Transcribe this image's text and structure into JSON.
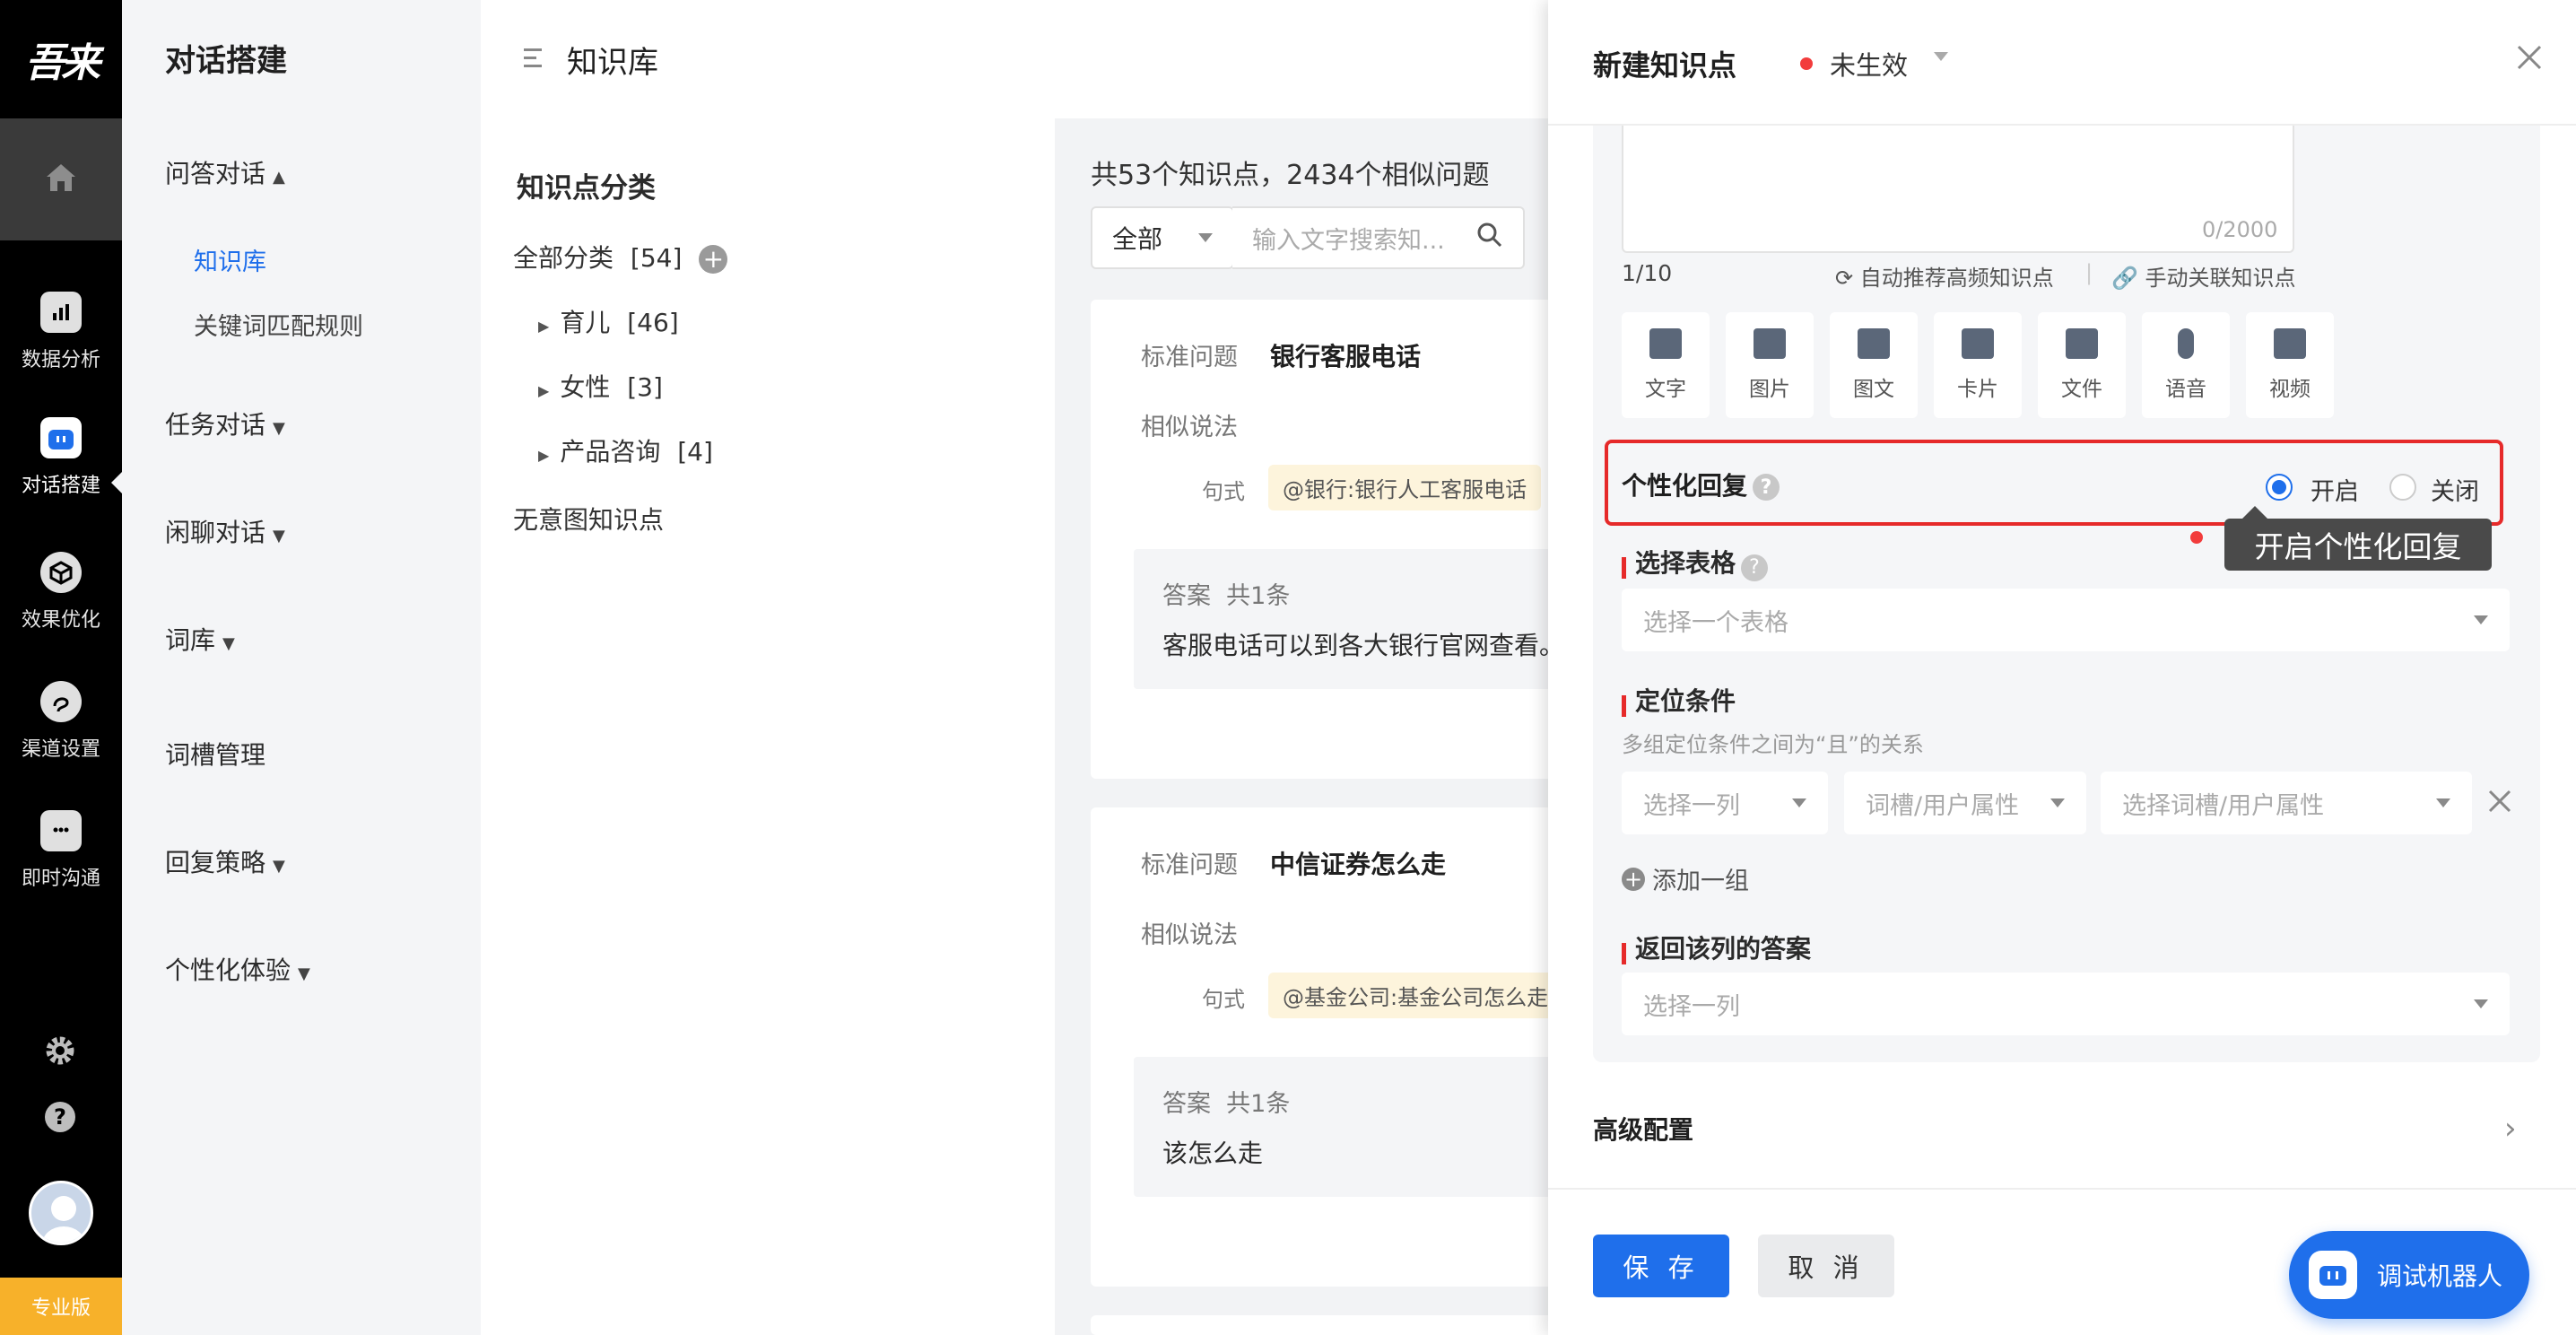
{
  "brand": {
    "logo": "吾来",
    "plan_badge": "专业版"
  },
  "rail": {
    "items": [
      {
        "label": "数据分析",
        "icon": "bar-chart-icon"
      },
      {
        "label": "对话搭建",
        "icon": "robot-icon"
      },
      {
        "label": "效果优化",
        "icon": "cube-icon"
      },
      {
        "label": "渠道设置",
        "icon": "channel-icon"
      },
      {
        "label": "即时沟通",
        "icon": "chat-bubble-icon"
      }
    ]
  },
  "nav2": {
    "title": "对话搭建",
    "items": [
      {
        "label": "问答对话"
      },
      {
        "label": "任务对话"
      },
      {
        "label": "闲聊对话"
      },
      {
        "label": "词库"
      },
      {
        "label": "词槽管理"
      },
      {
        "label": "回复策略"
      },
      {
        "label": "个性化体验"
      }
    ],
    "sub_items": [
      {
        "label": "知识库"
      },
      {
        "label": "关键词匹配规则"
      }
    ]
  },
  "main": {
    "title": "知识库",
    "category_title": "知识点分类",
    "categories": [
      {
        "label": "全部分类",
        "count": "[54]"
      },
      {
        "label": "育儿",
        "count": "[46]"
      },
      {
        "label": "女性",
        "count": "[3]"
      },
      {
        "label": "产品咨询",
        "count": "[4]"
      },
      {
        "label": "无意图知识点",
        "count": ""
      }
    ],
    "summary": "共53个知识点，2434个相似问题",
    "filter_value": "全部",
    "search_placeholder": "输入文字搜索知...",
    "cards": [
      {
        "std_label": "标准问题",
        "std_value": "银行客服电话",
        "sim_label": "相似说法",
        "pattern_label": "句式",
        "pattern_tag": "@银行:银行人工客服电话",
        "answer_label": "答案",
        "answer_count": "共1条",
        "answer_text": "客服电话可以到各大银行官网查看。"
      },
      {
        "std_label": "标准问题",
        "std_value": "中信证券怎么走",
        "sim_label": "相似说法",
        "pattern_label": "句式",
        "pattern_tag": "@基金公司:基金公司怎么走",
        "answer_label": "答案",
        "answer_count": "共1条",
        "answer_text": "该怎么走"
      }
    ]
  },
  "drawer": {
    "title": "新建知识点",
    "status": "未生效",
    "textarea_count": "0/2000",
    "page_counter": "1/10",
    "auto_recommend": "自动推荐高频知识点",
    "manual_link": "手动关联知识点",
    "tools": [
      "文字",
      "图片",
      "图文",
      "卡片",
      "文件",
      "语音",
      "视频"
    ],
    "personalized": {
      "label": "个性化回复",
      "on": "开启",
      "off": "关闭",
      "selected": "开启"
    },
    "tooltip": "开启个性化回复",
    "table": {
      "label": "选择表格",
      "placeholder": "选择一个表格"
    },
    "locate": {
      "label": "定位条件",
      "hint": "多组定位条件之间为“且”的关系",
      "col_placeholder": "选择一列",
      "attr_placeholder": "词槽/用户属性",
      "value_placeholder": "选择词槽/用户属性",
      "add_group": "添加一组"
    },
    "return_col": {
      "label": "返回该列的答案",
      "placeholder": "选择一列"
    },
    "advanced": "高级配置",
    "save": "保 存",
    "cancel": "取 消",
    "debug": "调试机器人"
  },
  "colors": {
    "accent": "#1f6feb",
    "highlight": "#e62a2a",
    "badge": "#f7b12a"
  }
}
